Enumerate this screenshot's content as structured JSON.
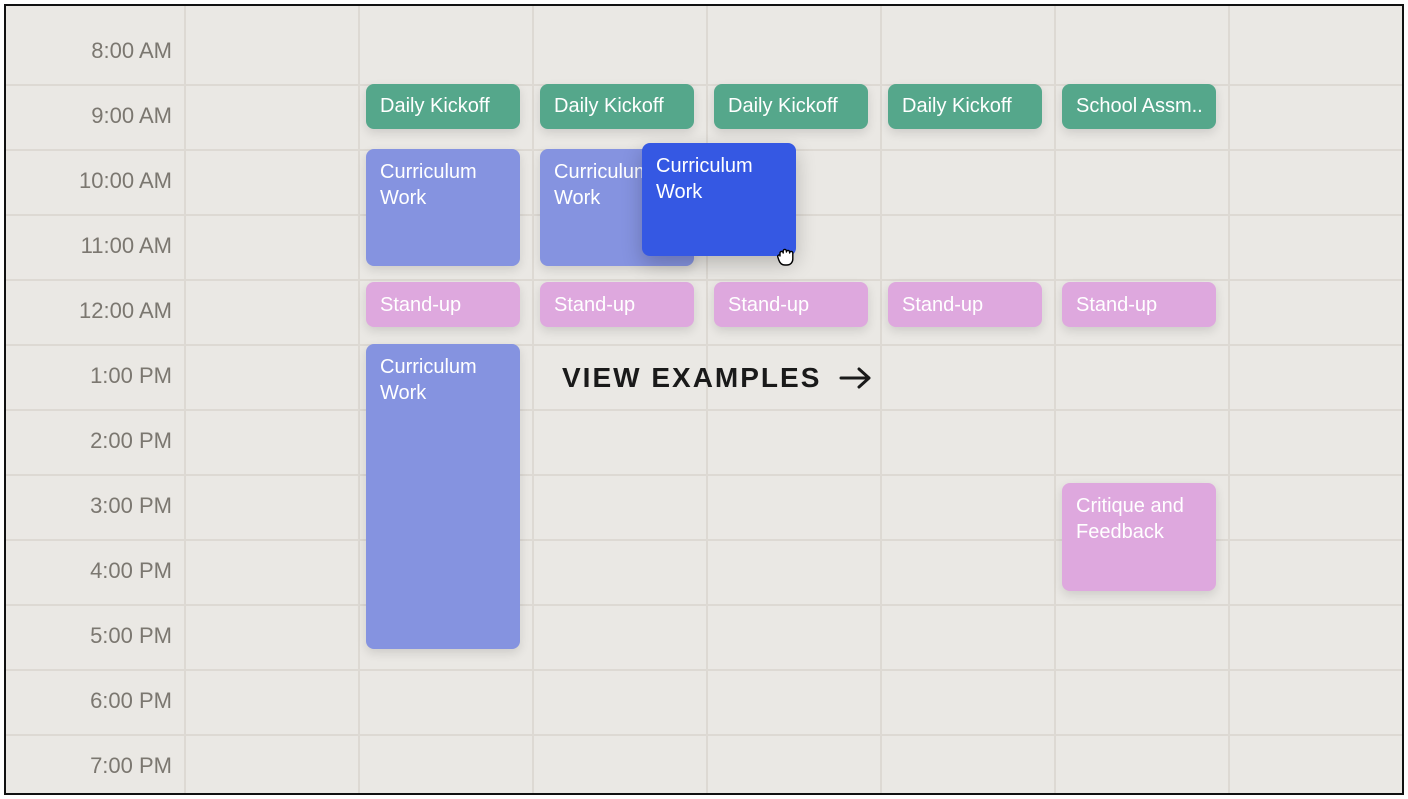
{
  "times": [
    "8:00 AM",
    "9:00 AM",
    "10:00 AM",
    "11:00 AM",
    "12:00 AM",
    "1:00 PM",
    "2:00 PM",
    "3:00 PM",
    "4:00 PM",
    "5:00 PM",
    "6:00 PM",
    "7:00 PM"
  ],
  "layout": {
    "firstHourY": 45,
    "hourHeight": 65,
    "timeColWidth": 178,
    "dayColStart": 178,
    "dayColWidth": 174,
    "numDayCols": 7
  },
  "colors": {
    "green": "#55a78b",
    "blueLight": "#8593e0",
    "blue": "#3558e3",
    "pink": "#dea8de"
  },
  "events": [
    {
      "id": "kickoff-1",
      "label": "Daily Kickoff",
      "col": 1,
      "startHour": 8.5,
      "durHours": 0.7,
      "colorClass": "c-green",
      "single": true
    },
    {
      "id": "kickoff-2",
      "label": "Daily Kickoff",
      "col": 2,
      "startHour": 8.5,
      "durHours": 0.7,
      "colorClass": "c-green",
      "single": true
    },
    {
      "id": "kickoff-3",
      "label": "Daily Kickoff",
      "col": 3,
      "startHour": 8.5,
      "durHours": 0.7,
      "colorClass": "c-green",
      "single": true
    },
    {
      "id": "kickoff-4",
      "label": "Daily Kickoff",
      "col": 4,
      "startHour": 8.5,
      "durHours": 0.7,
      "colorClass": "c-green",
      "single": true
    },
    {
      "id": "school-assm",
      "label": "School Assm..",
      "col": 5,
      "startHour": 8.5,
      "durHours": 0.7,
      "colorClass": "c-green",
      "single": true
    },
    {
      "id": "curr-1",
      "label": "Curriculum\nWork",
      "col": 1,
      "startHour": 9.5,
      "durHours": 1.8,
      "colorClass": "c-blue-l"
    },
    {
      "id": "curr-2",
      "label": "Curriculum\nWork",
      "col": 2,
      "startHour": 9.5,
      "durHours": 1.8,
      "colorClass": "c-blue-l"
    },
    {
      "id": "standup-1",
      "label": "Stand-up",
      "col": 1,
      "startHour": 11.55,
      "durHours": 0.7,
      "colorClass": "c-pink",
      "single": true
    },
    {
      "id": "standup-2",
      "label": "Stand-up",
      "col": 2,
      "startHour": 11.55,
      "durHours": 0.7,
      "colorClass": "c-pink",
      "single": true
    },
    {
      "id": "standup-3",
      "label": "Stand-up",
      "col": 3,
      "startHour": 11.55,
      "durHours": 0.7,
      "colorClass": "c-pink",
      "single": true
    },
    {
      "id": "standup-4",
      "label": "Stand-up",
      "col": 4,
      "startHour": 11.55,
      "durHours": 0.7,
      "colorClass": "c-pink",
      "single": true
    },
    {
      "id": "standup-5",
      "label": "Stand-up",
      "col": 5,
      "startHour": 11.55,
      "durHours": 0.7,
      "colorClass": "c-pink",
      "single": true
    },
    {
      "id": "curr-3",
      "label": "Curriculum\nWork",
      "col": 1,
      "startHour": 12.5,
      "durHours": 4.7,
      "colorClass": "c-blue-l"
    },
    {
      "id": "critique",
      "label": "Critique and\nFeedback",
      "col": 5,
      "startHour": 14.65,
      "durHours": 1.65,
      "colorClass": "c-pink"
    }
  ],
  "draggingEvent": {
    "id": "curr-drag",
    "label": "Curriculum\nWork",
    "xPx": 636,
    "yPx": 137,
    "wPx": 154,
    "hPx": 113,
    "colorClass": "c-blue"
  },
  "cursor": {
    "xPx": 768,
    "yPx": 238
  },
  "cta": {
    "label": "VIEW EXAMPLES",
    "xPx": 556,
    "yPx": 356
  }
}
